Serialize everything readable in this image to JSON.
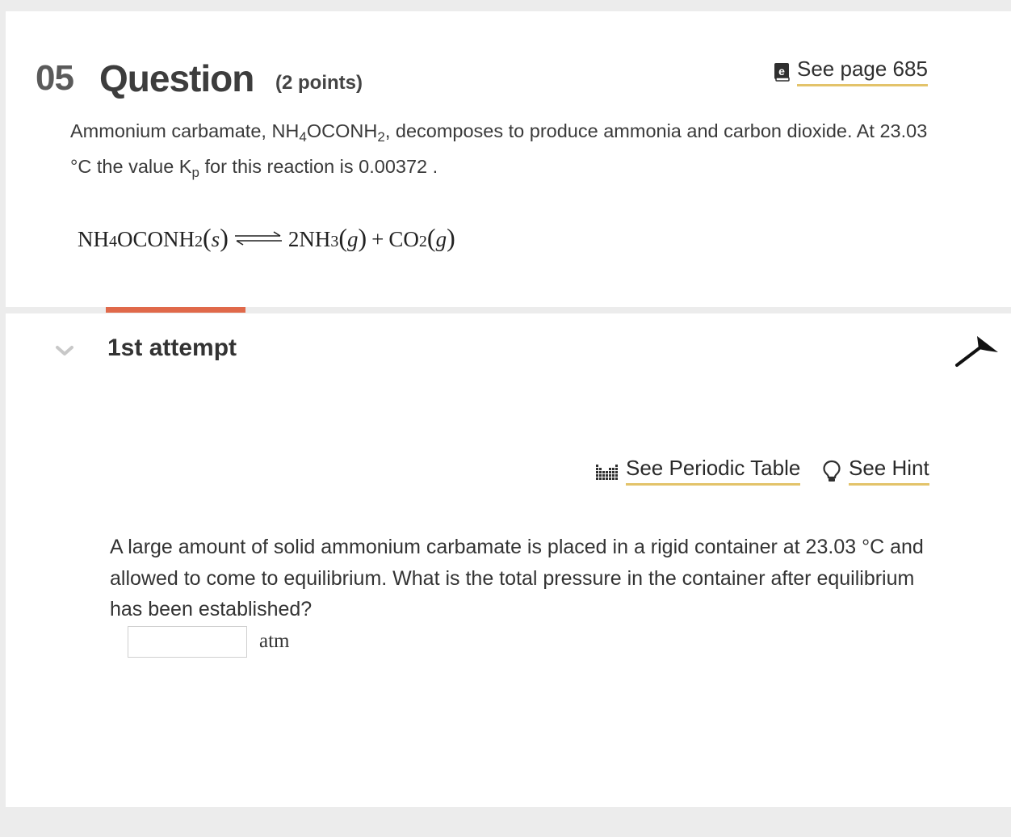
{
  "question": {
    "number": "05",
    "title": "Question",
    "points": "(2 points)",
    "see_page_label": "See page 685"
  },
  "intro": {
    "part1": "Ammonium carbamate, NH",
    "sub1": "4",
    "part2": "OCONH",
    "sub2": "2",
    "part3": ", decomposes to produce ammonia and carbon dioxide. At 23.03 °C the value K",
    "sub3": "p",
    "part4": " for this reaction is 0.00372 ."
  },
  "equation": {
    "reactant_a": "NH",
    "reactant_sub_a": "4",
    "reactant_b": "OCONH",
    "reactant_sub_b": "2",
    "reactant_state": "s",
    "product1": "2NH",
    "product1_sub": "3",
    "product1_state": "g",
    "plus": "+",
    "product2": "CO",
    "product2_sub": "2",
    "product2_state": "g"
  },
  "attempt": {
    "label": "1st attempt"
  },
  "tools": {
    "periodic_table_label": "See Periodic Table",
    "hint_label": "See Hint"
  },
  "prompt": {
    "text": "A large amount of solid ammonium carbamate is placed in a rigid container at 23.03 °C and allowed to come to equilibrium. What is the total pressure in the container after equilibrium has been established?"
  },
  "answer": {
    "value": "",
    "unit": "atm"
  },
  "colors": {
    "accent_orange": "#e0694a",
    "link_underline": "#e3c36a",
    "background": "#ececec"
  },
  "icons": {
    "ebook": "ebook-icon",
    "periodic_table": "periodic-table-icon",
    "hint": "lightbulb-icon",
    "collapse": "chevron-down-icon",
    "pin": "pin-icon"
  }
}
